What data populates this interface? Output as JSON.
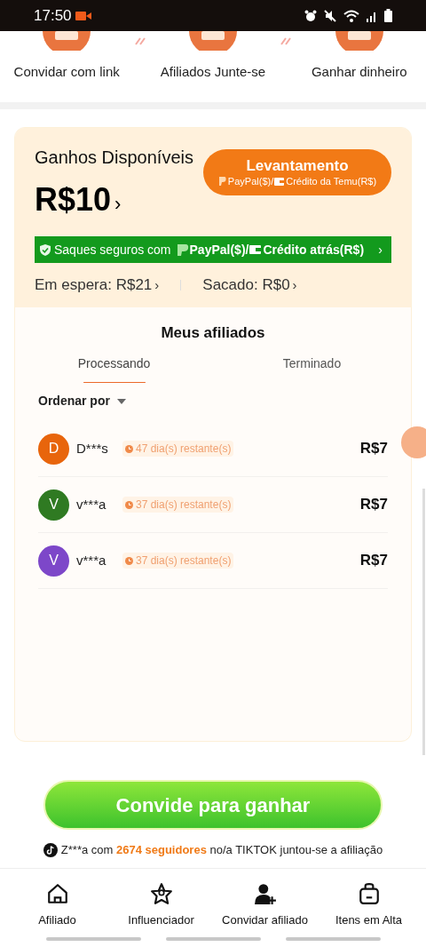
{
  "status_bar": {
    "time": "17:50"
  },
  "steps": [
    {
      "label": "Convidar com link"
    },
    {
      "label": "Afiliados Junte-se"
    },
    {
      "label": "Ganhar dinheiro"
    }
  ],
  "earnings": {
    "title": "Ganhos Disponíveis",
    "amount": "R$10",
    "chevron": "›",
    "withdraw_button": {
      "label": "Levantamento",
      "sub_paypal": "PayPal($)/",
      "sub_credit": "Crédito da Temu(R$)"
    },
    "safe_banner": {
      "text": "Saques seguros com",
      "paypal": "PayPal($)/",
      "credit": "Crédito atrás(R$)",
      "chevron": "›"
    },
    "pending": {
      "label": "Em espera: R$21",
      "chevron": "›"
    },
    "withdrawn": {
      "label": "Sacado: R$0",
      "chevron": "›"
    }
  },
  "affiliates": {
    "title": "Meus afiliados",
    "tabs": [
      {
        "label": "Processando",
        "selected": true
      },
      {
        "label": "Terminado",
        "selected": false
      }
    ],
    "sort_label": "Ordenar por",
    "rows": [
      {
        "initial": "D",
        "color": "#e8650c",
        "name": "D***s",
        "remaining": "47 dia(s) restante(s)",
        "amount": "R$7"
      },
      {
        "initial": "V",
        "color": "#2f7a22",
        "name": "v***a",
        "remaining": "37 dia(s) restante(s)",
        "amount": "R$7"
      },
      {
        "initial": "V",
        "color": "#7d47c9",
        "name": "v***a",
        "remaining": "37 dia(s) restante(s)",
        "amount": "R$7"
      }
    ]
  },
  "invite_button": {
    "label": "Convide para ganhar"
  },
  "ticker": {
    "prefix": "Z***a com",
    "highlight": "2674 seguidores",
    "suffix": "no/a TIKTOK juntou-se a afiliação"
  },
  "bottom_nav": [
    {
      "label": "Afiliado",
      "kind": "home"
    },
    {
      "label": "Influenciador",
      "kind": "star"
    },
    {
      "label": "Convidar afiliado",
      "kind": "user-add"
    },
    {
      "label": "Itens em Alta",
      "kind": "bag"
    }
  ]
}
